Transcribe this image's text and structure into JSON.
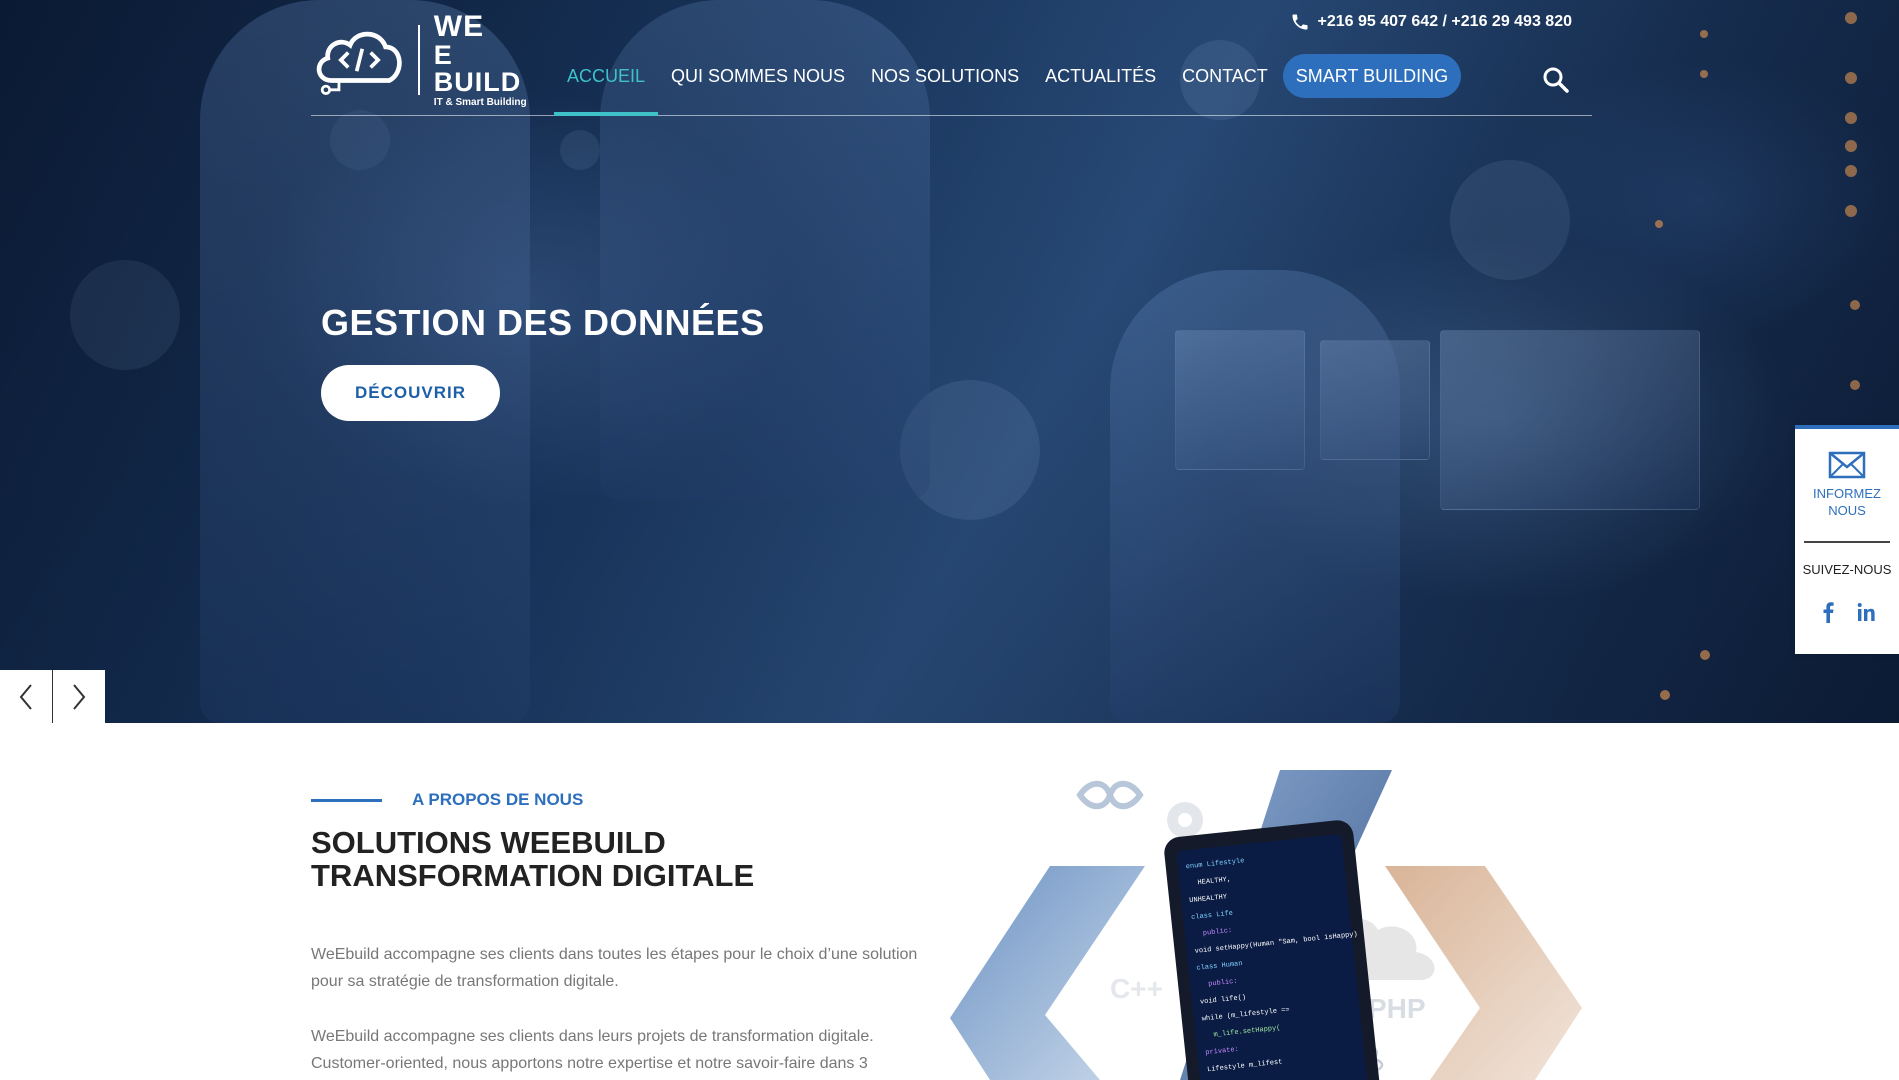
{
  "header": {
    "logo": {
      "line1": "WE",
      "line2": "E BUILD",
      "tagline": "IT & Smart Building"
    },
    "phone": "+216 95 407 642 / +216 29 493 820",
    "nav": [
      {
        "label": "ACCUEIL",
        "active": true
      },
      {
        "label": "QUI SOMMES NOUS",
        "active": false
      },
      {
        "label": "NOS SOLUTIONS",
        "active": false
      },
      {
        "label": "ACTUALITÉS",
        "active": false
      },
      {
        "label": "CONTACT",
        "active": false
      }
    ],
    "cta": "SMART BUILDING",
    "icons": {
      "phone": "phone-icon",
      "search": "search-icon"
    }
  },
  "hero": {
    "title": "GESTION DES DONNÉES",
    "button": "DÉCOUVRIR",
    "arrows": [
      "chevron-left-icon",
      "chevron-right-icon"
    ]
  },
  "side_widget": {
    "contact_label_1": "INFORMEZ",
    "contact_label_2": "NOUS",
    "follow_label": "SUIVEZ-NOUS",
    "icons": [
      "mail-icon",
      "facebook-icon",
      "linkedin-icon"
    ]
  },
  "about": {
    "label": "A PROPOS DE NOUS",
    "title_line1": "SOLUTIONS WEEBUILD",
    "title_line2": "TRANSFORMATION DIGITALE",
    "p1_line1": "WeEbuild accompagne ses clients dans toutes les étapes pour le choix d’une solution",
    "p1_line2": "pour sa stratégie de transformation digitale.",
    "p2_line1": "WeEbuild accompagne ses clients dans leurs projets de transformation digitale.",
    "p2_line2": "Customer-oriented, nous apportons notre expertise et notre savoir-faire dans 3"
  },
  "illustration": {
    "labels": [
      "C++",
      "PHP"
    ],
    "code_lines": [
      "enum Lifestyle",
      "HEALTHY,",
      "UNHEALTHY",
      "class Life",
      "public:",
      "void setHappy(Human \"Sam, bool isHappy)",
      "class Human",
      "public:",
      "void life()",
      "while (m_lifestyle ==",
      "m_life.setHappy(",
      "private:",
      "Lifestyle m_lifest"
    ],
    "colors": {
      "accent": "#2d6fbd",
      "teal": "#3ec1c8"
    }
  }
}
